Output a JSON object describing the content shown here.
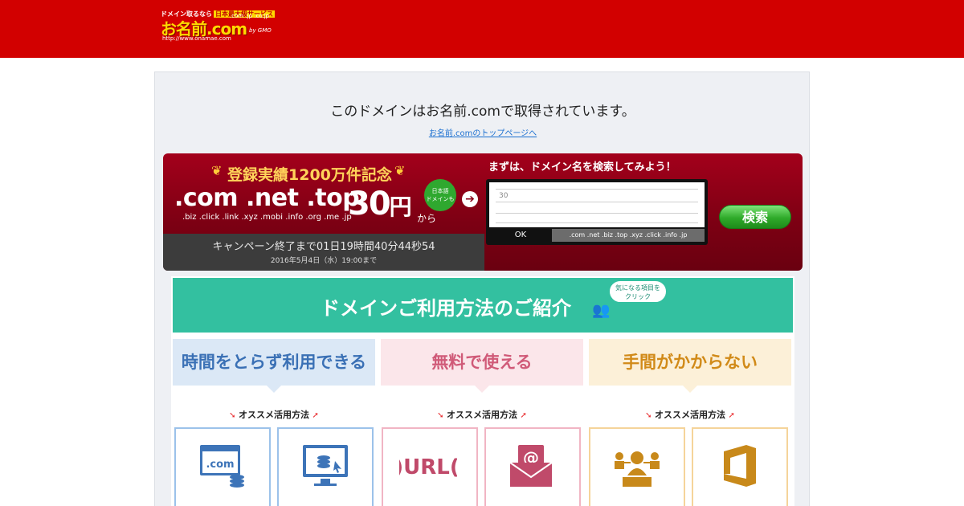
{
  "header": {
    "logo": {
      "tagline": "ドメイン取るなら",
      "tagline_highlight": "日本最大級サービス",
      "brand": "お名前.com",
      "tlds": ".com .jp .co.jp",
      "url": "http://www.onamae.com",
      "by": "by GMO"
    }
  },
  "main": {
    "headline": "このドメインはお名前.comで取得されています。",
    "sublink": "お名前.comのトップページへ"
  },
  "promo": {
    "campaign": "登録実績1200万件記念",
    "laurel_left": "❦",
    "laurel_right": "❦",
    "tlds_big": ".com .net .top",
    "tlds_small": ".biz .click .link .xyz .mobi .info .org .me .jp",
    "badge_line1": "日本語",
    "badge_line2": "ドメインも",
    "price": "30",
    "price_unit": "円",
    "price_from": "から",
    "countdown": "キャンペーン終了まで01日19時間40分44秒54",
    "until": "2016年5月4日（水）19:00まで",
    "search_title": "まずは、ドメイン名を検索してみよう！",
    "search_value": "30",
    "ok_label": "OK",
    "tld_strip": ".com .net .biz .top .xyz .click .info .jp",
    "search_button": "検索"
  },
  "usage": {
    "title": "ドメインご利用方法のご紹介",
    "bubble_line1": "気になる項目を",
    "bubble_line2": "クリック",
    "columns": [
      {
        "heading": "時間をとらず利用できる",
        "recommend": "オススメ活用方法"
      },
      {
        "heading": "無料で使える",
        "recommend": "オススメ活用方法"
      },
      {
        "heading": "手間がかからない",
        "recommend": "オススメ活用方法"
      }
    ],
    "cards": [
      {
        "icon": "dotcom-web-icon",
        "label": ".com"
      },
      {
        "icon": "monitor-coins-icon",
        "label": ""
      },
      {
        "icon": "url-icon",
        "label": ")URL("
      },
      {
        "icon": "email-at-icon",
        "label": "@"
      },
      {
        "icon": "people-network-icon",
        "label": ""
      },
      {
        "icon": "office-icon",
        "label": ""
      }
    ]
  },
  "colors": {
    "header_red": "#d20000",
    "teal": "#33c0a0",
    "blue": "#3a70b5",
    "pink": "#d05a78",
    "orange": "#d18a18"
  }
}
